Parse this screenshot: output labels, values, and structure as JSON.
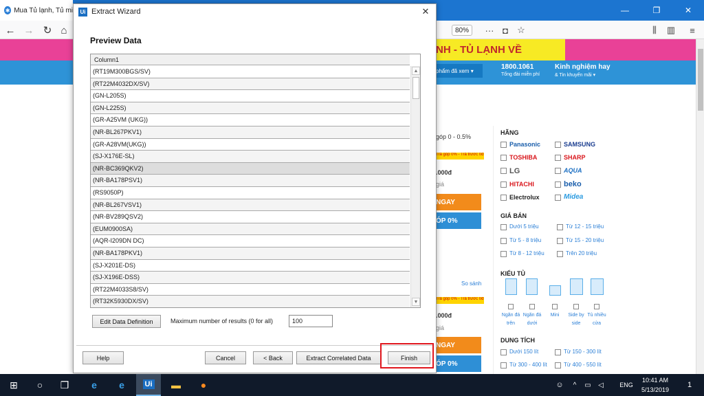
{
  "browser": {
    "tab_title": "Mua Tủ lạnh, Tủ mi",
    "zoom": "80%"
  },
  "page": {
    "banner_text": "NH - TỦ LẠNH VỀ",
    "dropdown_text": "phẩm đã xem ▾",
    "hotline": "1800.1061",
    "hotline_sub": "Tổng đài miễn phí",
    "exp_title": "Kinh nghiệm hay",
    "exp_sub": "& Tin khuyến mãi ▾",
    "installment": "góp 0 - 0.5%",
    "tag1": "Trả góp 0% - Trả trước 0đ",
    "price1": ".000đ",
    "gia1": "giá",
    "buy1": "NGAY",
    "gop1": "ÓP 0%",
    "compare": "So sánh",
    "tag2": "Trả góp 0% - Trả trước 0đ",
    "price2": ".000đ",
    "gia2": "giá",
    "buy2": "NGAY",
    "gop2": "ÓP 0%",
    "filter": {
      "brand_title": "HÃNG",
      "brands": [
        "Panasonic",
        "SAMSUNG",
        "TOSHIBA",
        "SHARP",
        "LG",
        "AQUA",
        "HITACHI",
        "beko",
        "Electrolux",
        "Midea"
      ],
      "price_title": "GIÁ BÁN",
      "prices": [
        "Dưới 5 triệu",
        "Từ 12 - 15 triệu",
        "Từ 5 - 8 triệu",
        "Từ 15 - 20 triệu",
        "Từ 8 - 12 triệu",
        "Trên 20 triệu"
      ],
      "type_title": "KIỂU TỦ",
      "types": [
        "Ngăn đá trên",
        "Ngăn đá dưới",
        "Mini",
        "Side by side",
        "Tủ nhiều cửa"
      ],
      "capacity_title": "DUNG TÍCH",
      "capacities": [
        "Dưới 150 lít",
        "Từ 150 - 300 lít",
        "Từ 300 - 400 lít",
        "Từ 400 - 550 lít"
      ]
    }
  },
  "dialog": {
    "title": "Extract Wizard",
    "heading": "Preview Data",
    "column_header": "Column1",
    "rows": [
      "(RT19M300BGS/SV)",
      "(RT22M4032DX/SV)",
      "(GN-L205S)",
      "(GN-L225S)",
      "(GR-A25VM (UKG))",
      "(NR-BL267PKV1)",
      "(GR-A28VM(UKG))",
      "(SJ-X176E-SL)",
      "(NR-BC369QKV2)",
      "(NR-BA178PSV1)",
      "(RS9050P)",
      "(NR-BL267VSV1)",
      "(NR-BV289QSV2)",
      "(EUM0900SA)",
      "(AQR-I209DN DC)",
      "(NR-BA178PKV1)",
      "(SJ-X201E-DS)",
      "(SJ-X196E-DSS)",
      "(RT22M4033S8/SV)",
      "(RT32K5930DX/SV)"
    ],
    "edit_button": "Edit Data Definition",
    "max_label": "Maximum number of results (0 for all)",
    "max_value": "100",
    "help": "Help",
    "cancel": "Cancel",
    "back": "< Back",
    "extract_correlated": "Extract Correlated Data",
    "finish": "Finish"
  },
  "taskbar": {
    "lang": "ENG",
    "time": "10:41 AM",
    "date": "5/13/2019",
    "notifications": "1"
  }
}
